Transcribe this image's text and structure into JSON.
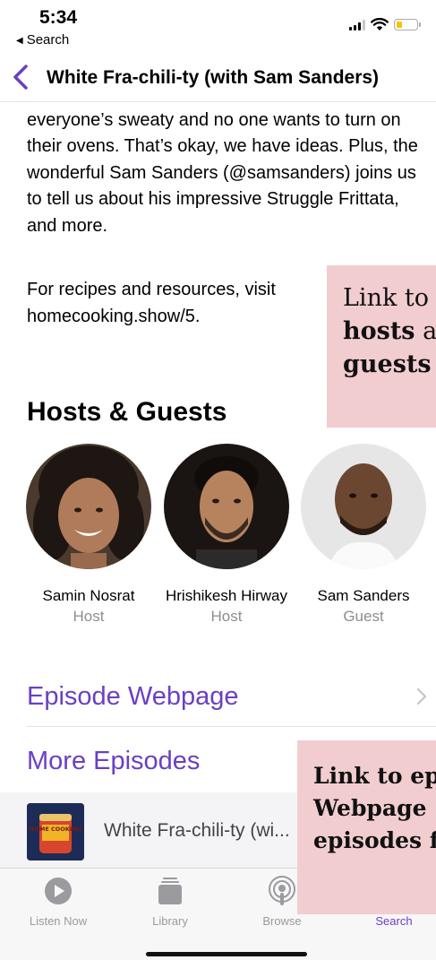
{
  "status_bar": {
    "time": "5:34",
    "back_label": "Search"
  },
  "nav": {
    "title": "White Fra-chili-ty (with Sam Sanders)"
  },
  "description": {
    "paragraph_1": "run, so we have, too! But now, it’s hot out and everyone’s sweaty and no one wants to turn on their ovens. That’s okay, we have ideas. Plus, the wonderful Sam Sanders (@samsanders) joins us to tell us about his impressive Struggle Frittata, and more.",
    "paragraph_2": "For recipes and resources, visit homecooking.show/5."
  },
  "hosts_section": {
    "title": "Hosts & Guests",
    "people": [
      {
        "name": "Samin Nosrat",
        "role": "Host"
      },
      {
        "name": "Hrishikesh Hirway",
        "role": "Host"
      },
      {
        "name": "Sam Sanders",
        "role": "Guest"
      }
    ]
  },
  "links": {
    "episode_webpage": "Episode Webpage",
    "more_episodes": "More Episodes"
  },
  "episode": {
    "title": "White Fra-chili-ty (wi...",
    "art_text": "HOME COOKING"
  },
  "tabs": [
    {
      "label": "Listen Now",
      "icon": "play-circle-icon",
      "active": false
    },
    {
      "label": "Library",
      "icon": "library-stack-icon",
      "active": false
    },
    {
      "label": "Browse",
      "icon": "podcast-broadcast-icon",
      "active": false
    },
    {
      "label": "Search",
      "icon": "search-icon",
      "active": true
    }
  ],
  "annotations": {
    "note_1": {
      "line_1": "Link to",
      "line_2a": "hosts",
      "line_2b": "and",
      "line_3": "guests"
    },
    "note_2": {
      "line_1": "Link to episode",
      "line_2": "Webpage + more",
      "line_3": "episodes from"
    }
  },
  "colors": {
    "accent": "#6b3fc4",
    "secondary_text": "#8e8e93",
    "annotation_background": "#f2cdd0"
  }
}
